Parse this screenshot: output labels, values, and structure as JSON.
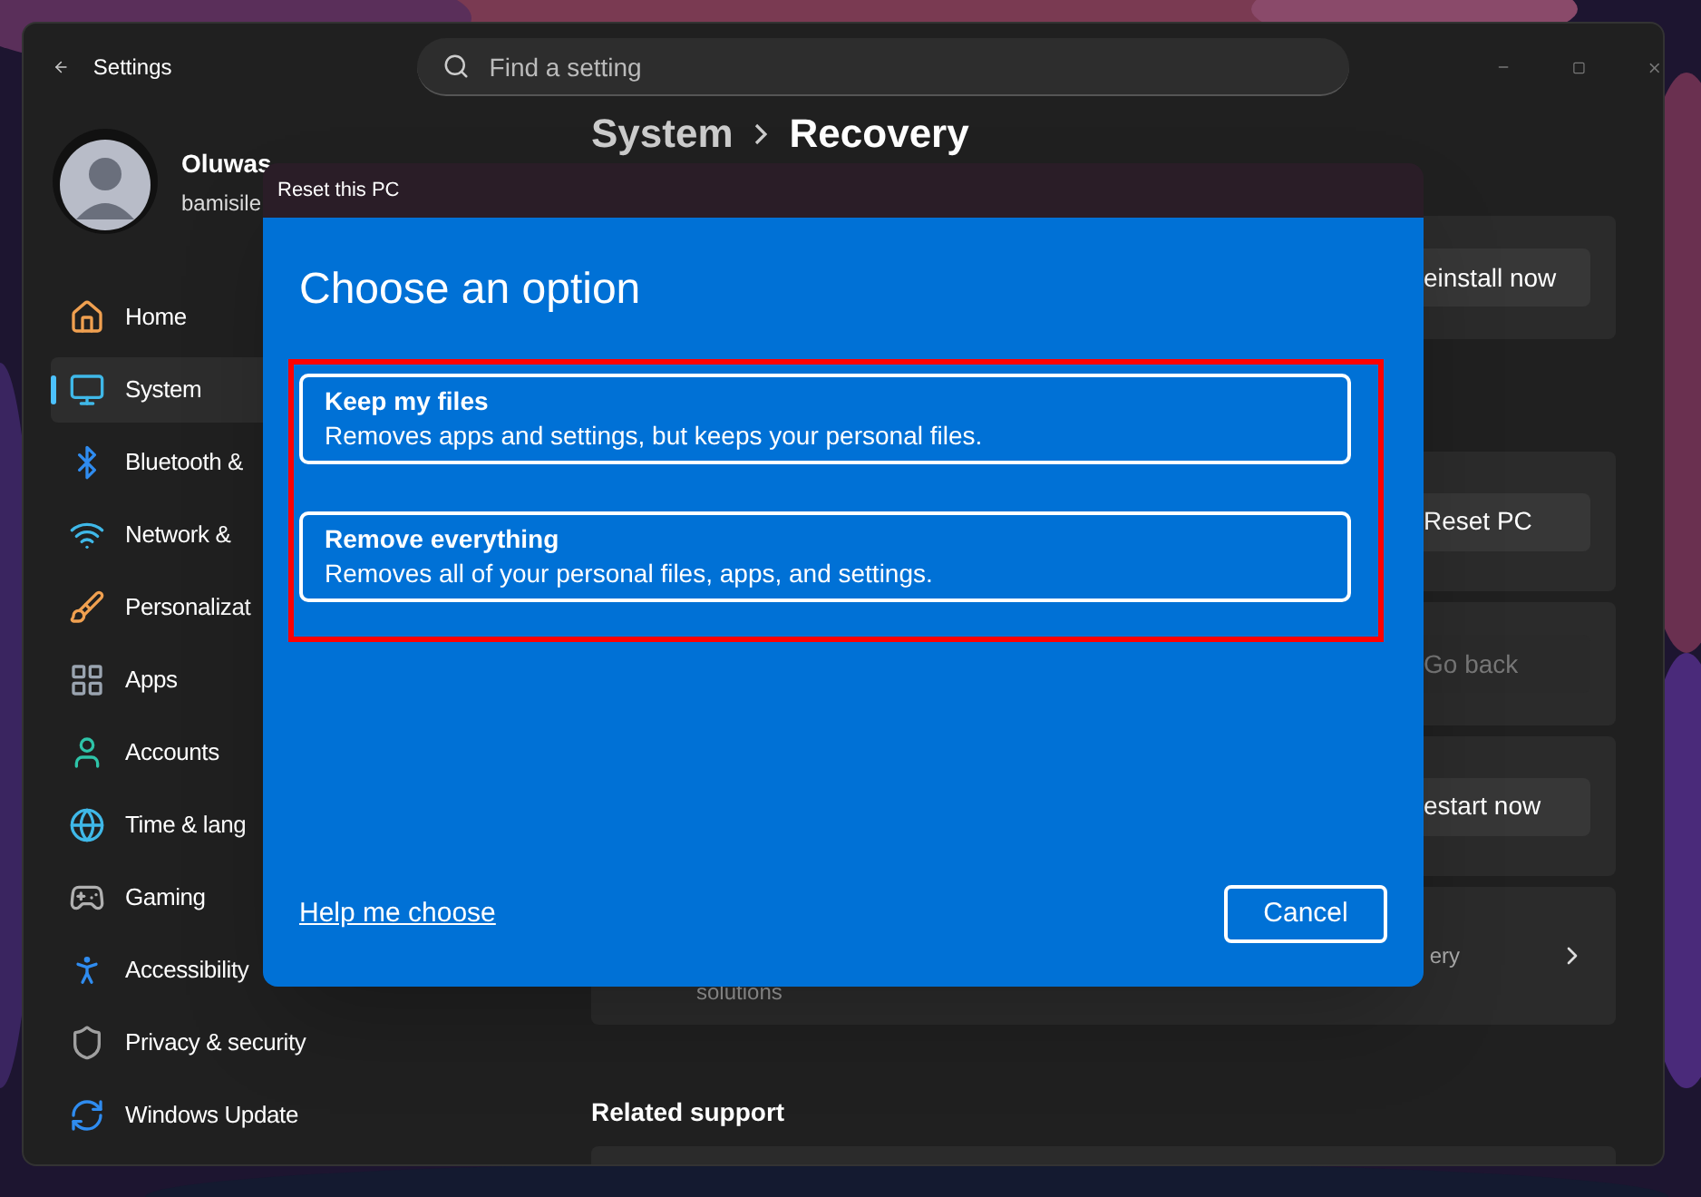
{
  "window": {
    "title": "Settings",
    "search": {
      "placeholder": "Find a setting"
    }
  },
  "profile": {
    "name": "Oluwas",
    "email": "bamisile"
  },
  "sidebar": {
    "items": [
      {
        "label": "Home",
        "selected": false
      },
      {
        "label": "System",
        "selected": true
      },
      {
        "label": "Bluetooth &",
        "selected": false
      },
      {
        "label": "Network &",
        "selected": false
      },
      {
        "label": "Personalizat",
        "selected": false
      },
      {
        "label": "Apps",
        "selected": false
      },
      {
        "label": "Accounts",
        "selected": false
      },
      {
        "label": "Time & lang",
        "selected": false
      },
      {
        "label": "Gaming",
        "selected": false
      },
      {
        "label": "Accessibility",
        "selected": false
      },
      {
        "label": "Privacy & security",
        "selected": false
      },
      {
        "label": "Windows Update",
        "selected": false
      }
    ]
  },
  "breadcrumb": [
    "System",
    "Recovery"
  ],
  "top_card": {
    "button": "einstall now",
    "disabled": false
  },
  "recovery_options": [
    {
      "kind": "button",
      "button": "Reset PC",
      "disabled": false
    },
    {
      "kind": "button",
      "button": "Go back",
      "disabled": true
    },
    {
      "kind": "button",
      "button": "estart now",
      "disabled": false
    },
    {
      "kind": "link",
      "text": "ery",
      "subtitle": "solutions"
    }
  ],
  "related_support": {
    "title": "Related support"
  },
  "dialog": {
    "title": "Reset this PC",
    "heading": "Choose an option",
    "options": [
      {
        "title": "Keep my files",
        "description": "Removes apps and settings, but keeps your personal files."
      },
      {
        "title": "Remove everything",
        "description": "Removes all of your personal files, apps, and settings."
      }
    ],
    "link": "Help me choose",
    "cancel": "Cancel"
  }
}
